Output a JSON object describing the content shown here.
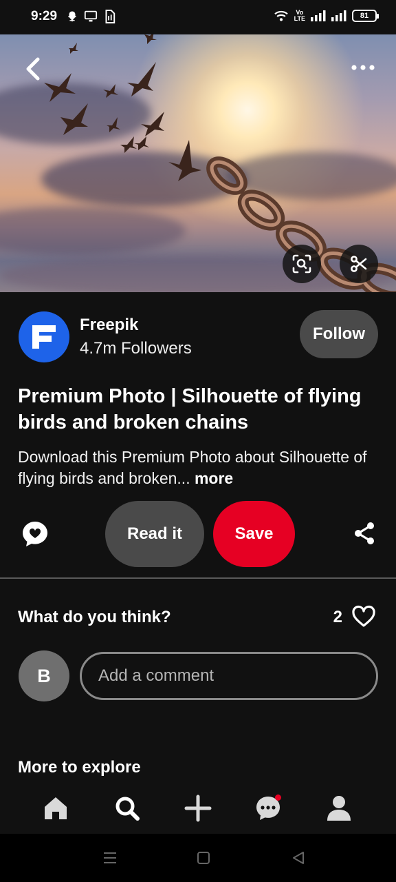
{
  "status_bar": {
    "time": "9:29",
    "battery": "81",
    "volte_line1": "Vo",
    "volte_line2": "LTE"
  },
  "creator": {
    "name": "Freepik",
    "followers": "4.7m Followers",
    "follow_label": "Follow",
    "brand_color": "#1e63e9"
  },
  "pin": {
    "title": "Premium Photo | Silhouette of flying birds and broken chains",
    "description": "Download this Premium Photo about Silhouette of flying birds and broken...",
    "more_label": "more"
  },
  "actions": {
    "read_label": "Read it",
    "save_label": "Save",
    "save_color": "#e60023"
  },
  "feedback": {
    "prompt": "What do you think?",
    "like_count": "2"
  },
  "comment": {
    "user_initial": "B",
    "placeholder": "Add a comment"
  },
  "explore": {
    "label": "More to explore"
  },
  "bottom_nav": {
    "items": [
      "home-icon",
      "search-icon",
      "plus-icon",
      "messages-icon",
      "profile-icon"
    ],
    "active": "search-icon"
  }
}
